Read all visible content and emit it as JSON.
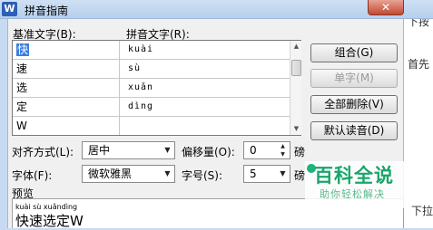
{
  "window": {
    "title": "拼音指南",
    "close_glyph": "✕",
    "app_glyph": "W"
  },
  "background_text": {
    "top_right": "下按",
    "mid_right": "首先",
    "bottom_right": "下拉"
  },
  "grid": {
    "col_base_label": "基准文字(B):",
    "col_pinyin_label": "拼音文字(R):",
    "rows": [
      {
        "base": "快",
        "pinyin": "kuài"
      },
      {
        "base": "速",
        "pinyin": "sù"
      },
      {
        "base": "选",
        "pinyin": "xuǎn"
      },
      {
        "base": "定",
        "pinyin": "dìng"
      },
      {
        "base": "W",
        "pinyin": ""
      }
    ]
  },
  "buttons": {
    "combine": "组合(G)",
    "single": "单字(M)",
    "delete_all": "全部删除(V)",
    "default_reading": "默认读音(D)"
  },
  "options": {
    "alignment_label": "对齐方式(L):",
    "alignment_value": "居中",
    "offset_label": "偏移量(O):",
    "offset_value": "0",
    "offset_unit": "磅",
    "font_label": "字体(F):",
    "font_value": "微软雅黑",
    "size_label": "字号(S):",
    "size_value": "5",
    "size_unit": "磅"
  },
  "preview": {
    "label": "预览",
    "pinyin": "kuài sù xuǎndìng",
    "text": "快速选定W"
  },
  "watermark": {
    "title": "百科全说",
    "subtitle": "助你轻松解决"
  }
}
